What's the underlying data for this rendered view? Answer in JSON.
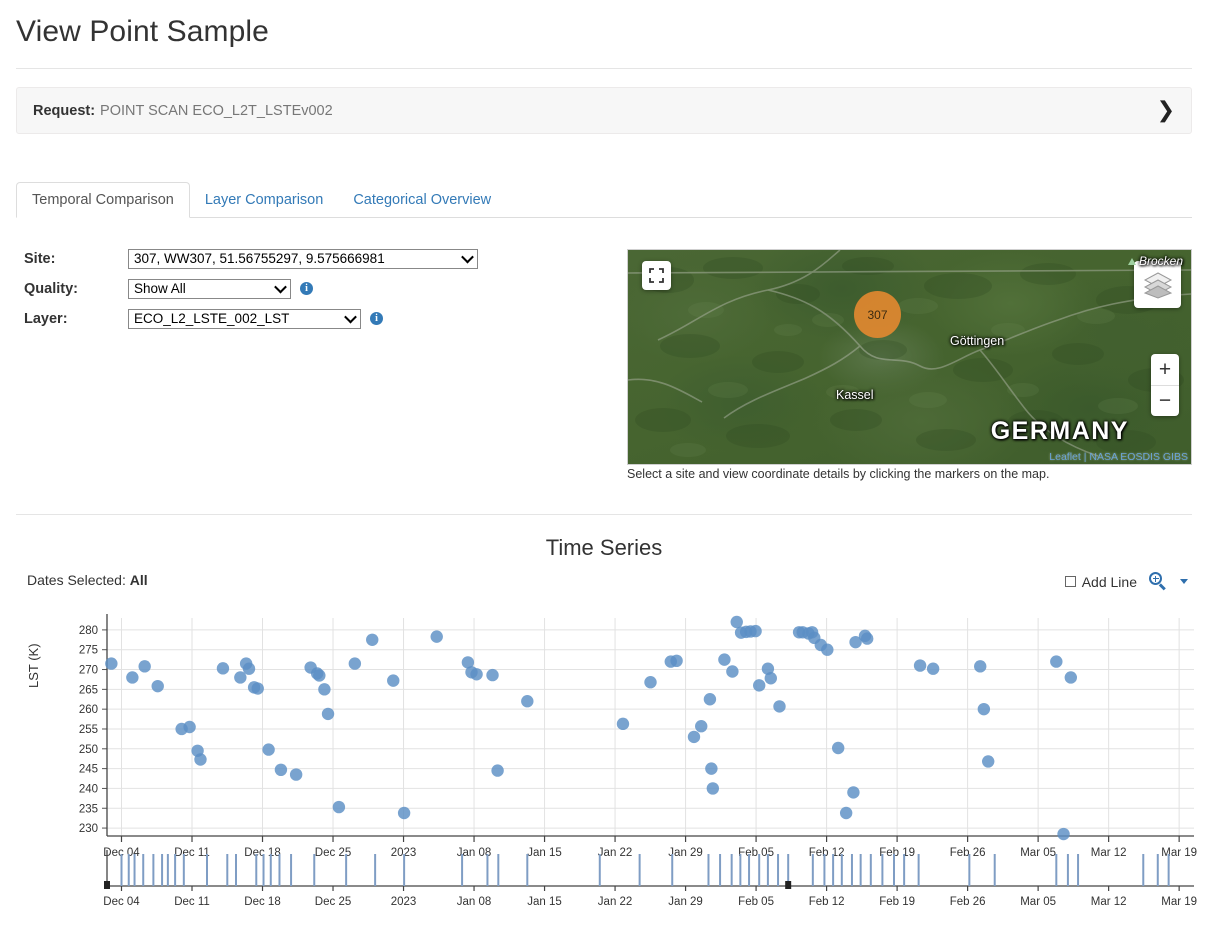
{
  "header": {
    "title": "View Point Sample"
  },
  "request": {
    "label": "Request:",
    "value": "POINT SCAN ECO_L2T_LSTEv002",
    "expand_icon": "❯"
  },
  "tabs": [
    {
      "label": "Temporal Comparison",
      "active": true
    },
    {
      "label": "Layer Comparison",
      "active": false
    },
    {
      "label": "Categorical Overview",
      "active": false
    }
  ],
  "form": {
    "site": {
      "label": "Site:",
      "value": "307, WW307, 51.56755297, 9.575666981"
    },
    "quality": {
      "label": "Quality:",
      "value": "Show All",
      "info": "i"
    },
    "layer": {
      "label": "Layer:",
      "value": "ECO_L2_LSTE_002_LST",
      "info": "i"
    }
  },
  "map": {
    "marker_label": "307",
    "labels": {
      "brocken": "Brocken",
      "gottingen": "Göttingen",
      "kassel": "Kassel",
      "country": "GERMANY"
    },
    "attribution": "Leaflet | NASA EOSDIS GIBS",
    "zoom_in": "+",
    "zoom_out": "−",
    "caption": "Select a site and view coordinate details by clicking the markers on the map."
  },
  "timeseries": {
    "title": "Time Series",
    "dates_selected_label": "Dates Selected:",
    "dates_selected_value": "All",
    "add_line_label": "Add Line"
  },
  "chart_data": {
    "type": "scatter",
    "title": "Time Series",
    "xlabel": "",
    "ylabel": "LST (K)",
    "ylim": [
      228,
      283
    ],
    "yticks": [
      230,
      235,
      240,
      245,
      250,
      255,
      260,
      265,
      270,
      275,
      280
    ],
    "xticks": [
      "Dec 04",
      "Dec 11",
      "Dec 18",
      "Dec 25",
      "2023",
      "Jan 08",
      "Jan 15",
      "Jan 22",
      "Jan 29",
      "Feb 05",
      "Feb 12",
      "Feb 19",
      "Feb 26",
      "Mar 05",
      "Mar 12",
      "Mar 19"
    ],
    "xrange": [
      "Dec 01",
      "Mar 21"
    ],
    "grid": true,
    "legend": false,
    "marker_color": "#5b8fc4",
    "points": [
      {
        "x": 0.6,
        "y": 271.5
      },
      {
        "x": 3.5,
        "y": 268.0
      },
      {
        "x": 5.2,
        "y": 270.8
      },
      {
        "x": 7.0,
        "y": 265.8
      },
      {
        "x": 10.3,
        "y": 255.0
      },
      {
        "x": 11.4,
        "y": 255.5
      },
      {
        "x": 12.5,
        "y": 249.5
      },
      {
        "x": 12.9,
        "y": 247.3
      },
      {
        "x": 16.0,
        "y": 270.3
      },
      {
        "x": 18.4,
        "y": 268.0
      },
      {
        "x": 19.2,
        "y": 271.5
      },
      {
        "x": 19.6,
        "y": 270.2
      },
      {
        "x": 20.3,
        "y": 265.5
      },
      {
        "x": 20.8,
        "y": 265.2
      },
      {
        "x": 22.3,
        "y": 249.8
      },
      {
        "x": 24.0,
        "y": 244.7
      },
      {
        "x": 26.1,
        "y": 243.5
      },
      {
        "x": 28.1,
        "y": 270.5
      },
      {
        "x": 29.0,
        "y": 269.0
      },
      {
        "x": 29.3,
        "y": 268.5
      },
      {
        "x": 30.0,
        "y": 265.0
      },
      {
        "x": 30.5,
        "y": 258.8
      },
      {
        "x": 32.0,
        "y": 235.3
      },
      {
        "x": 34.2,
        "y": 271.5
      },
      {
        "x": 36.6,
        "y": 277.5
      },
      {
        "x": 39.5,
        "y": 267.2
      },
      {
        "x": 41.0,
        "y": 233.8
      },
      {
        "x": 45.5,
        "y": 278.3
      },
      {
        "x": 49.8,
        "y": 271.8
      },
      {
        "x": 50.3,
        "y": 269.3
      },
      {
        "x": 51.0,
        "y": 268.8
      },
      {
        "x": 53.2,
        "y": 268.6
      },
      {
        "x": 53.9,
        "y": 244.5
      },
      {
        "x": 58.0,
        "y": 262.0
      },
      {
        "x": 71.2,
        "y": 256.3
      },
      {
        "x": 75.0,
        "y": 266.8
      },
      {
        "x": 77.8,
        "y": 272.0
      },
      {
        "x": 78.6,
        "y": 272.2
      },
      {
        "x": 81.0,
        "y": 253.0
      },
      {
        "x": 82.0,
        "y": 255.7
      },
      {
        "x": 83.2,
        "y": 262.5
      },
      {
        "x": 83.4,
        "y": 245.0
      },
      {
        "x": 83.6,
        "y": 240.0
      },
      {
        "x": 85.2,
        "y": 272.5
      },
      {
        "x": 86.3,
        "y": 269.5
      },
      {
        "x": 86.9,
        "y": 282.0
      },
      {
        "x": 87.5,
        "y": 279.3
      },
      {
        "x": 88.2,
        "y": 279.5
      },
      {
        "x": 88.8,
        "y": 279.6
      },
      {
        "x": 89.5,
        "y": 279.7
      },
      {
        "x": 90.0,
        "y": 266.0
      },
      {
        "x": 91.2,
        "y": 270.2
      },
      {
        "x": 91.6,
        "y": 267.8
      },
      {
        "x": 92.8,
        "y": 260.7
      },
      {
        "x": 95.5,
        "y": 279.4
      },
      {
        "x": 96.0,
        "y": 279.4
      },
      {
        "x": 96.8,
        "y": 279.1
      },
      {
        "x": 97.3,
        "y": 279.4
      },
      {
        "x": 97.6,
        "y": 278.0
      },
      {
        "x": 98.5,
        "y": 276.2
      },
      {
        "x": 99.4,
        "y": 275.0
      },
      {
        "x": 100.9,
        "y": 250.2
      },
      {
        "x": 103.3,
        "y": 276.9
      },
      {
        "x": 104.6,
        "y": 278.5
      },
      {
        "x": 104.9,
        "y": 277.8
      },
      {
        "x": 102.0,
        "y": 233.8
      },
      {
        "x": 103.0,
        "y": 239.0
      },
      {
        "x": 112.2,
        "y": 271.0
      },
      {
        "x": 114.0,
        "y": 270.2
      },
      {
        "x": 120.5,
        "y": 270.8
      },
      {
        "x": 121.0,
        "y": 260.0
      },
      {
        "x": 121.6,
        "y": 246.8
      },
      {
        "x": 131.0,
        "y": 272.0
      },
      {
        "x": 133.0,
        "y": 268.0
      },
      {
        "x": 132.0,
        "y": 228.5
      }
    ],
    "selector_ticks": [
      2.0,
      3.0,
      3.8,
      5.0,
      6.4,
      7.6,
      8.4,
      9.4,
      10.6,
      13.8,
      16.6,
      17.8,
      20.6,
      21.6,
      22.6,
      23.8,
      25.4,
      28.6,
      33.0,
      37.0,
      41.0,
      49.0,
      52.5,
      54.0,
      58.0,
      68.0,
      73.5,
      78.0,
      83.0,
      84.6,
      86.2,
      87.4,
      88.6,
      90.0,
      91.2,
      92.6,
      94.0,
      97.4,
      99.0,
      100.2,
      101.4,
      102.8,
      104.0,
      105.4,
      107.0,
      108.6,
      110.0,
      112.0,
      119.0,
      122.5,
      131.0,
      132.6,
      134.0,
      143.0,
      145.0,
      146.5
    ]
  }
}
